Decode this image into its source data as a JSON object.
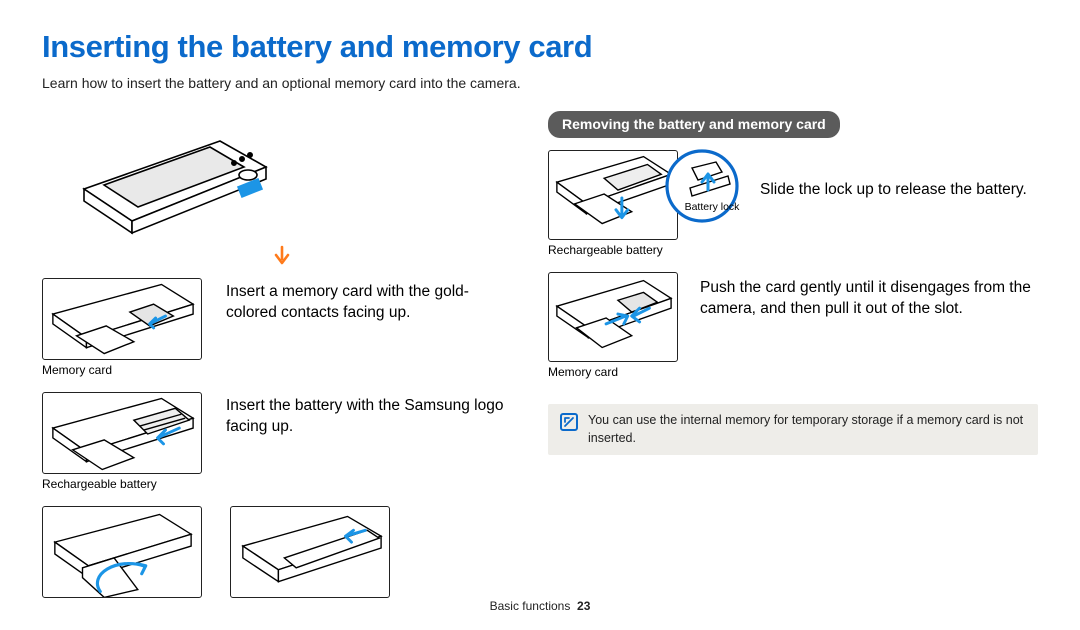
{
  "title": "Inserting the battery and memory card",
  "subtitle": "Learn how to insert the battery and an optional memory card into the camera.",
  "left": {
    "memory_card_caption": "Memory card",
    "memory_card_text": "Insert a memory card with the gold-colored contacts facing up.",
    "battery_caption": "Rechargeable battery",
    "battery_text": "Insert the battery with the Samsung logo facing up."
  },
  "right": {
    "heading": "Removing the battery and memory card",
    "battery_caption": "Rechargeable battery",
    "battery_lock_label": "Battery lock",
    "battery_text": "Slide the lock up to release the battery.",
    "memory_caption": "Memory card",
    "memory_text": "Push the card gently until it disengages from the camera, and then pull it out of the slot."
  },
  "note": "You can use the internal memory for temporary storage if a memory card is not inserted.",
  "footer": {
    "section": "Basic functions",
    "page": "23"
  },
  "colors": {
    "accent": "#0b6acb",
    "arrow_blue": "#1c95e6",
    "arrow_orange": "#ff7a1a"
  }
}
